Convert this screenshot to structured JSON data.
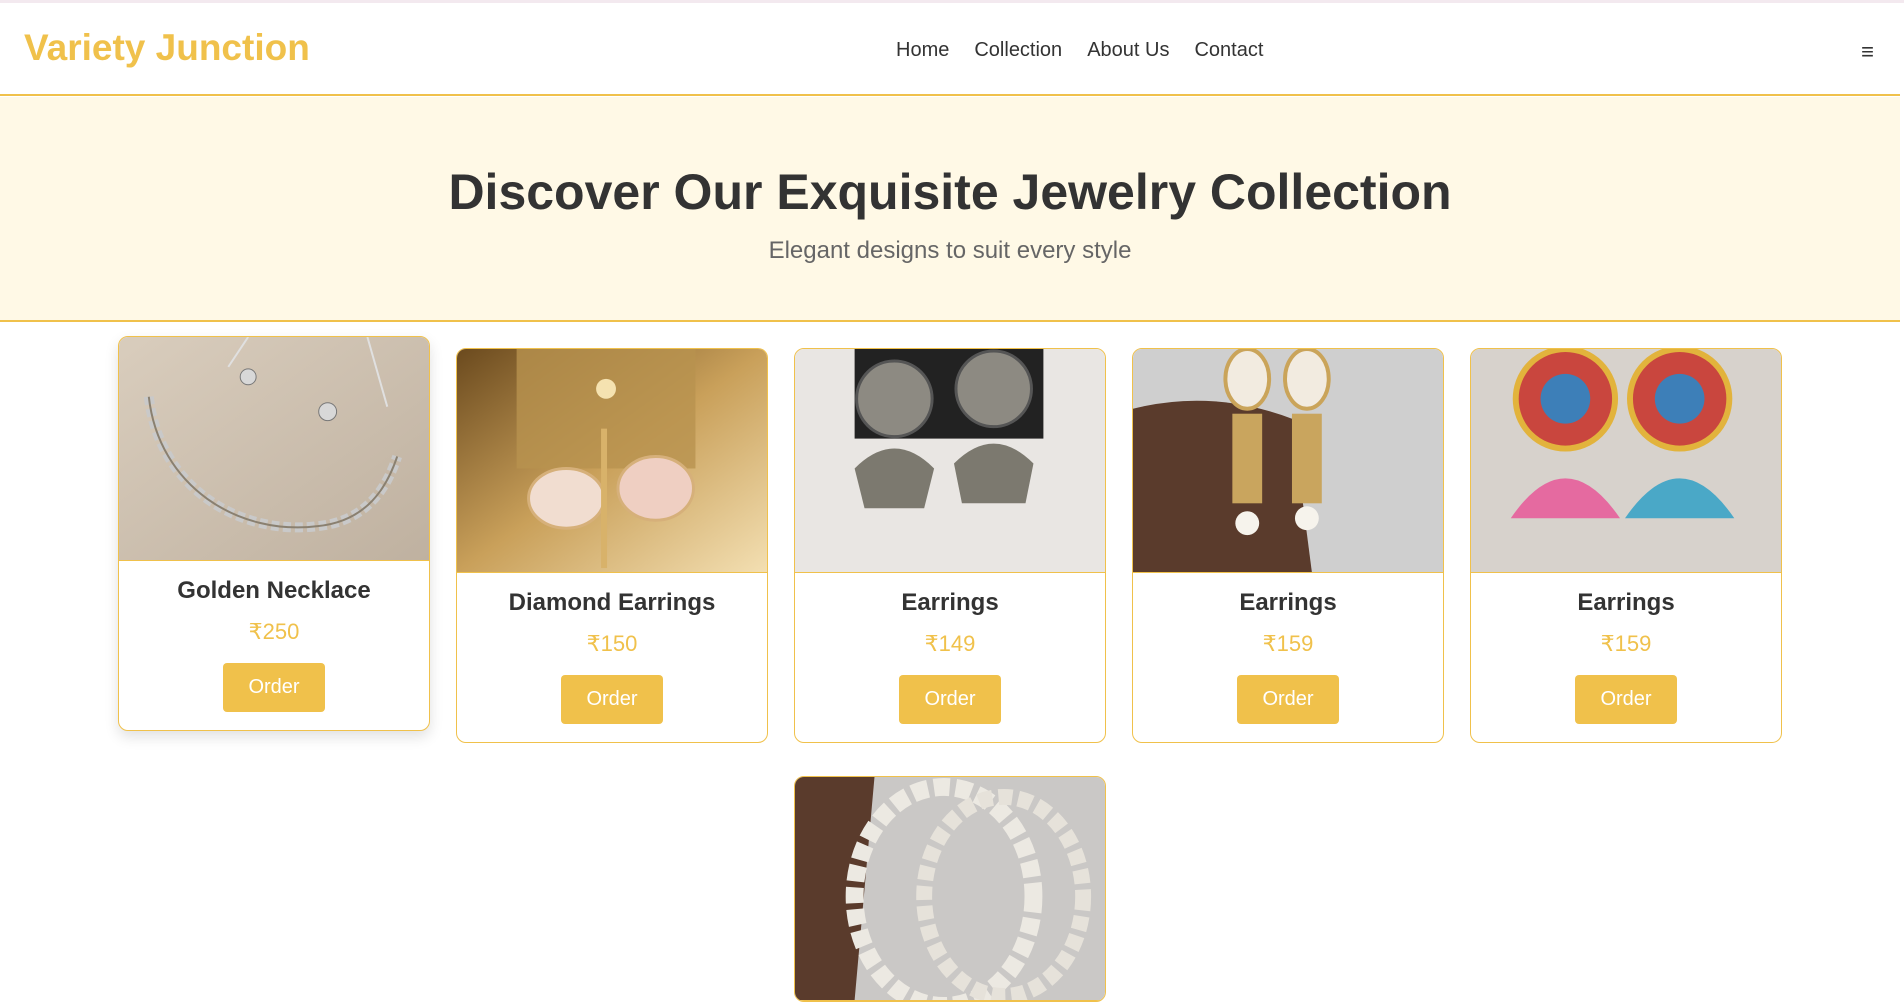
{
  "header": {
    "logo": "Variety Junction",
    "nav": [
      "Home",
      "Collection",
      "About Us",
      "Contact"
    ],
    "menu_icon": "≡"
  },
  "hero": {
    "title": "Discover Our Exquisite Jewelry Collection",
    "subtitle": "Elegant designs to suit every style"
  },
  "products": [
    {
      "name": "Golden Necklace",
      "price": "₹250",
      "button": "Order",
      "image": "necklace-photo"
    },
    {
      "name": "Diamond Earrings",
      "price": "₹150",
      "button": "Order",
      "image": "butterfly-earrings-photo"
    },
    {
      "name": "Earrings",
      "price": "₹149",
      "button": "Order",
      "image": "oxidized-jhumka-photo"
    },
    {
      "name": "Earrings",
      "price": "₹159",
      "button": "Order",
      "image": "pearl-drop-earrings-photo"
    },
    {
      "name": "Earrings",
      "price": "₹159",
      "button": "Order",
      "image": "colorful-jhumka-photo"
    },
    {
      "image": "pearl-bangles-photo"
    }
  ],
  "colors": {
    "accent": "#f0c14b",
    "hero_bg": "#fff9e6",
    "text": "#333333"
  }
}
